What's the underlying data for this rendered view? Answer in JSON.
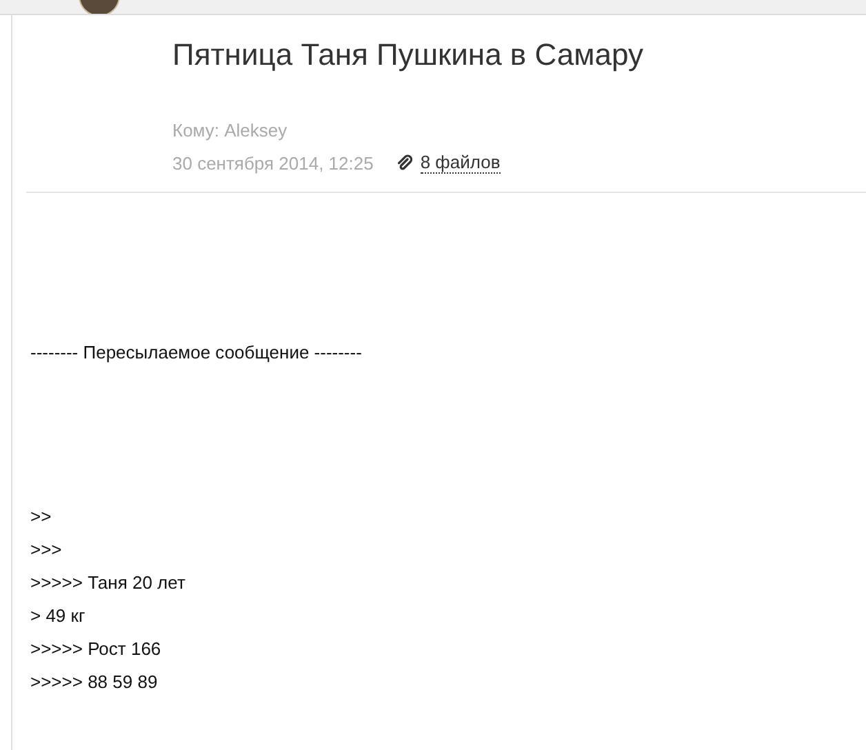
{
  "subject": "Пятница Таня Пушкина в Самару",
  "to": "Кому: Aleksey",
  "date": "30 сентября 2014, 12:25",
  "attachments": "8 файлов",
  "forwarded_header": "-------- Пересылаемое сообщение --------",
  "quoted_lines": [
    ">>",
    ">>>",
    ">>>>> Таня 20 лет",
    "> 49 кг",
    ">>>>> Рост 166",
    ">>>>> 88 59 89"
  ]
}
